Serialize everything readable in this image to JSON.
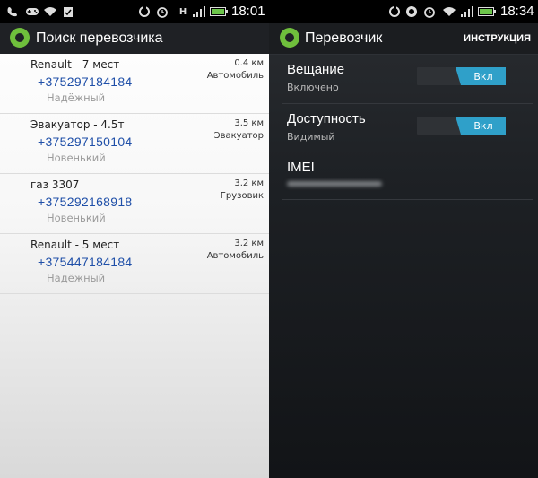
{
  "left": {
    "status": {
      "time": "18:01",
      "indicator": "H"
    },
    "appbar": {
      "title": "Поиск перевозчика"
    },
    "results": [
      {
        "name": "Renault - 7 мест",
        "phone": "+375297184184",
        "rating": "Надёжный",
        "distance": "0.4 км",
        "type": "Автомобиль"
      },
      {
        "name": "Эвакуатор - 4.5т",
        "phone": "+375297150104",
        "rating": "Новенький",
        "distance": "3.5 км",
        "type": "Эвакуатор"
      },
      {
        "name": "газ 3307",
        "phone": "+375292168918",
        "rating": "Новенький",
        "distance": "3.2 км",
        "type": "Грузовик"
      },
      {
        "name": "Renault - 5 мест",
        "phone": "+375447184184",
        "rating": "Надёжный",
        "distance": "3.2 км",
        "type": "Автомобиль"
      }
    ]
  },
  "right": {
    "status": {
      "time": "18:34"
    },
    "appbar": {
      "title": "Перевозчик",
      "action": "ИНСТРУКЦИЯ"
    },
    "settings": [
      {
        "title": "Вещание",
        "subtitle": "Включено",
        "toggle": "Вкл"
      },
      {
        "title": "Доступность",
        "subtitle": "Видимый",
        "toggle": "Вкл"
      },
      {
        "title": "IMEI"
      }
    ]
  },
  "colors": {
    "accent": "#2fa0c9",
    "logo": "#6fbf3c",
    "phone": "#1f4fa8"
  }
}
